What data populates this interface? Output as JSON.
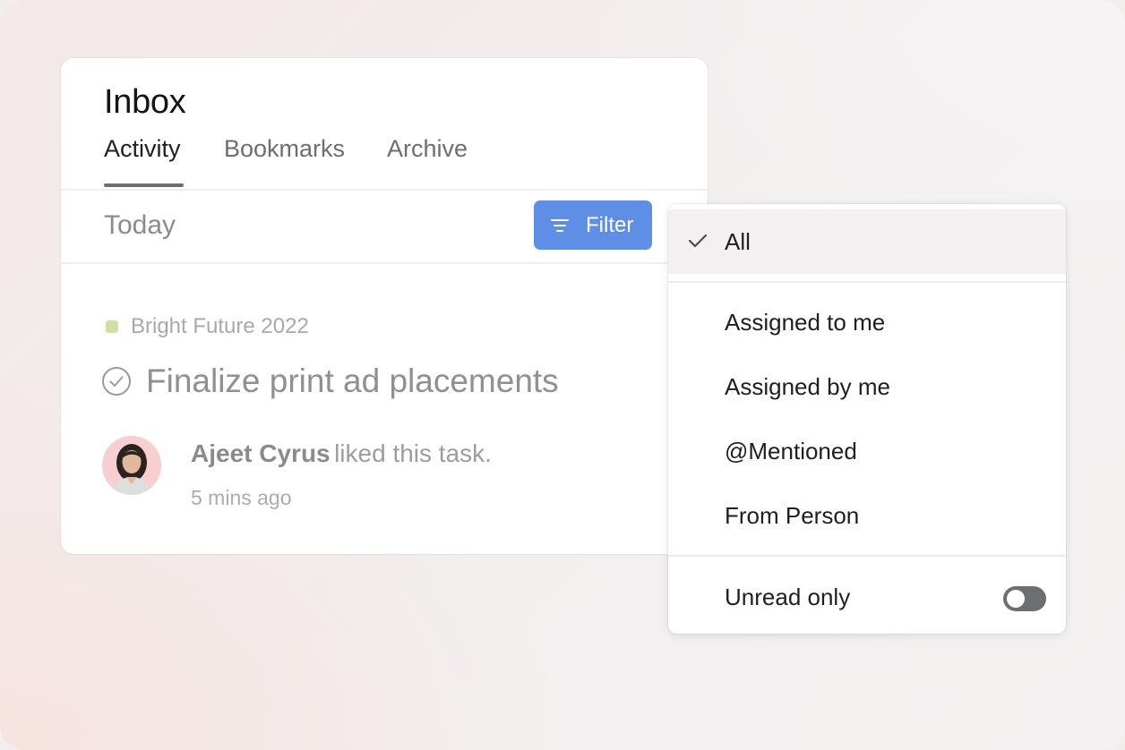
{
  "inbox": {
    "title": "Inbox",
    "tabs": [
      {
        "label": "Activity",
        "active": true
      },
      {
        "label": "Bookmarks",
        "active": false
      },
      {
        "label": "Archive",
        "active": false
      }
    ],
    "section_label": "Today",
    "filter_label": "Filter"
  },
  "notification": {
    "project": "Bright Future 2022",
    "project_color": "#cfe0a4",
    "task": "Finalize print ad placements",
    "actor": "Ajeet Cyrus",
    "action": "liked this task.",
    "time": "5 mins ago"
  },
  "filter_menu": {
    "selected": "All",
    "items": [
      "All",
      "Assigned to me",
      "Assigned by me",
      "@Mentioned",
      "From Person"
    ],
    "unread_only_label": "Unread only",
    "unread_only_enabled": false
  },
  "colors": {
    "filter_button": "#5f8ee7",
    "toggle_off": "#6d6e6f"
  },
  "icons": {
    "filter": "filter-lines-icon",
    "task_check": "check-circle-icon",
    "selected_mark": "checkmark-icon"
  }
}
